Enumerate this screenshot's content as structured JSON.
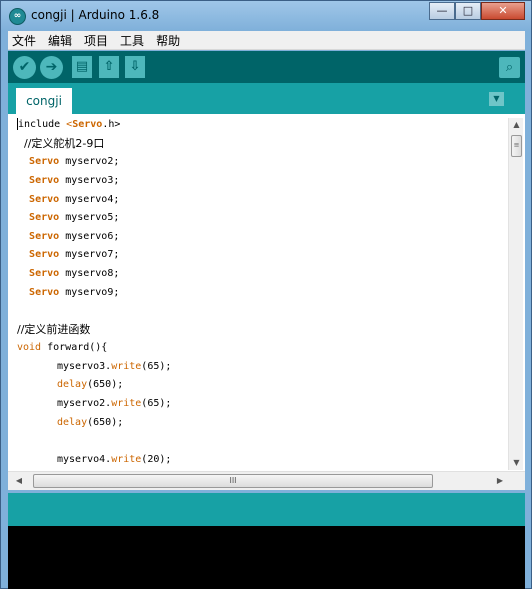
{
  "window": {
    "app_icon": "arduino-icon",
    "title": "congji | Arduino 1.6.8",
    "minimize": "—",
    "maximize": "□",
    "close": "✕"
  },
  "menu": [
    "文件",
    "编辑",
    "项目",
    "工具",
    "帮助"
  ],
  "toolbar": {
    "verify_icon": "✔",
    "upload_icon": "➔",
    "new_icon": "▤",
    "open_icon": "⇧",
    "save_icon": "⇩",
    "serial_icon": "⌕"
  },
  "tabs": [
    {
      "label": "congji"
    }
  ],
  "tab_menu_icon": "▼",
  "code": {
    "l1_pre": "include ",
    "l1_lt": "<",
    "l1_kw": "Servo",
    "l1_post": ".h>",
    "l2": "  //定义舵机2-9口",
    "servo_kw": "Servo",
    "servo_decls": [
      "myservo2;",
      "myservo3;",
      "myservo4;",
      "myservo5;",
      "myservo6;",
      "myservo7;",
      "myservo8;",
      "myservo9;"
    ],
    "l12": "//定义前进函数",
    "l13_kw": "void",
    "l13_name": " forward(){",
    "l14_obj": "myservo3.",
    "l14_fn": "write",
    "l14_arg": "(65);",
    "l15_fn": "delay",
    "l15_arg": "(650);",
    "l16_obj": "myservo2.",
    "l16_fn": "write",
    "l16_arg": "(65);",
    "l17_fn": "delay",
    "l17_arg": "(650);",
    "l19_obj": "myservo4.",
    "l19_fn": "write",
    "l19_arg": "(20);"
  },
  "scroll": {
    "up": "▲",
    "down": "▼",
    "left": "◀",
    "right": "▶",
    "grip_v": "≡",
    "grip_h": "III"
  },
  "colors": {
    "toolbar": "#006468",
    "tabstrip": "#17a1a5",
    "keyword": "#cc6600"
  }
}
